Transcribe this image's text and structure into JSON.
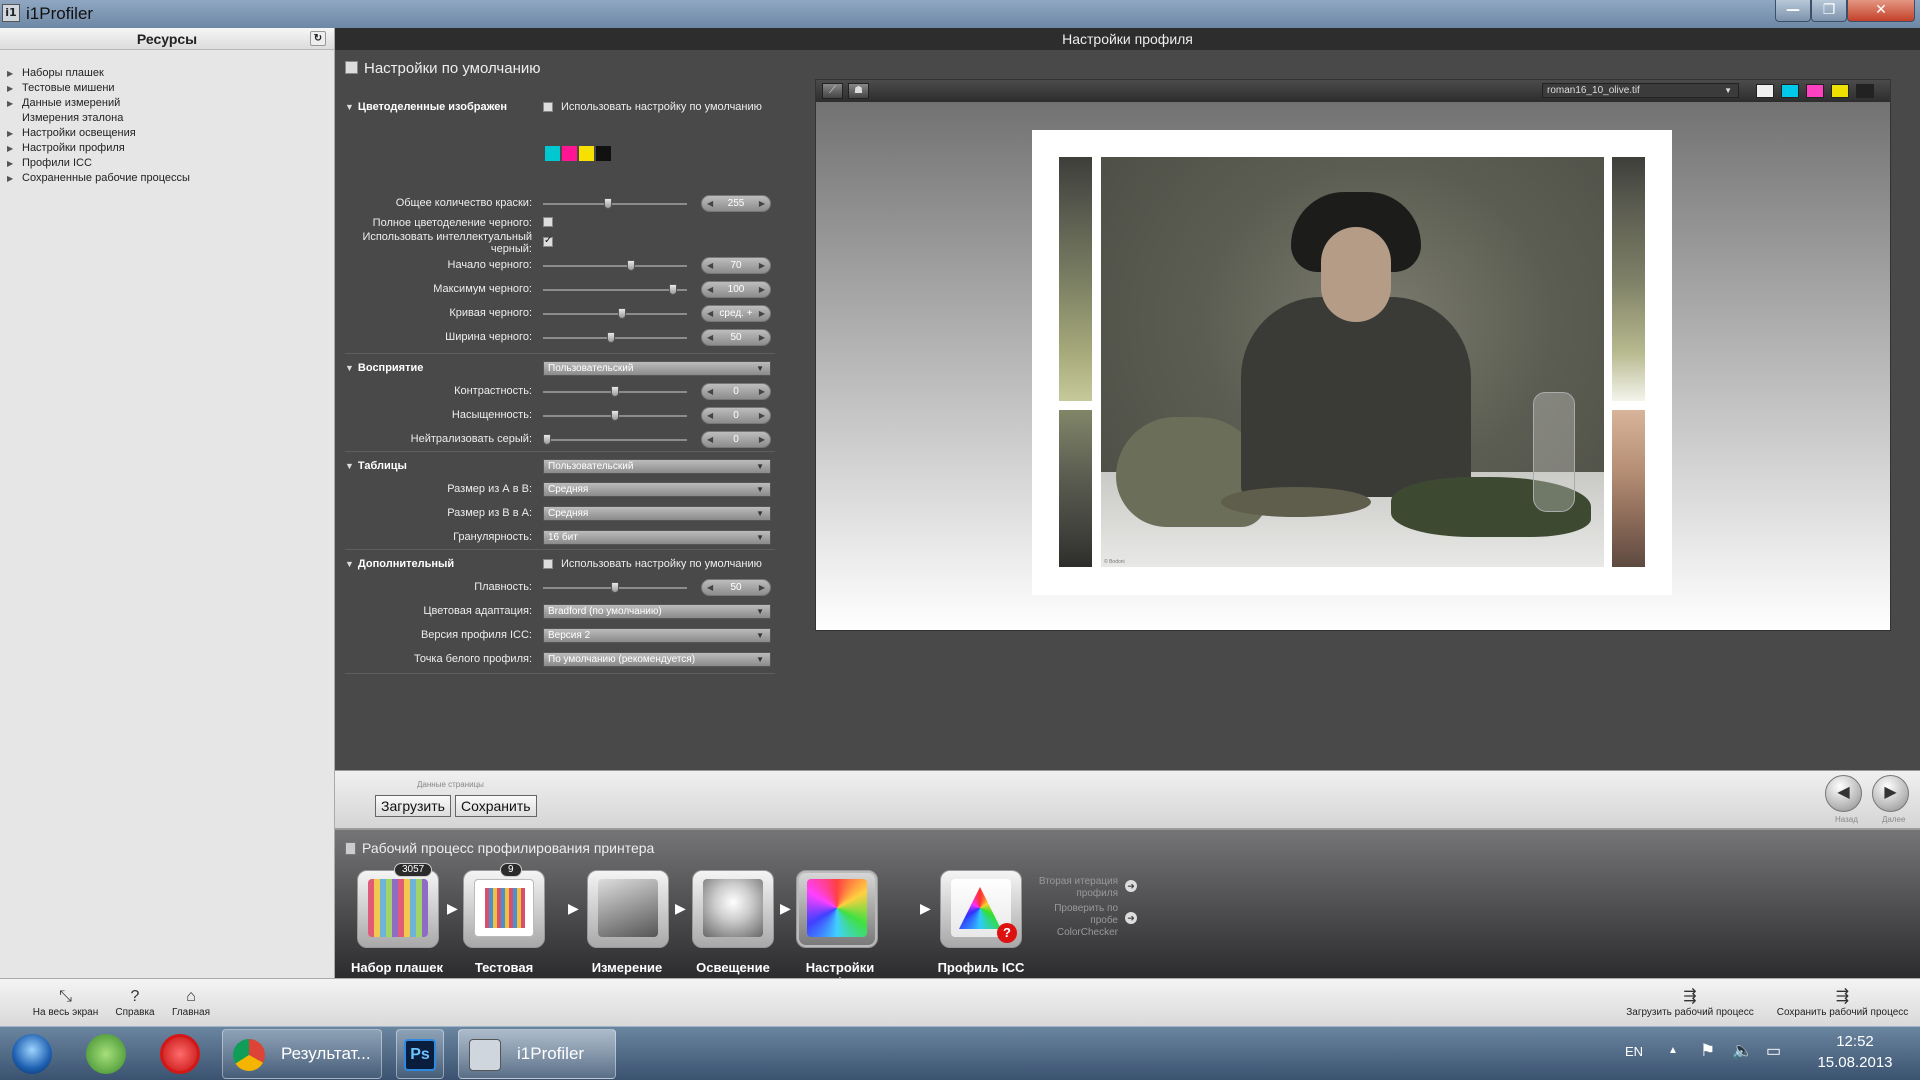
{
  "window": {
    "title": "i1Profiler",
    "app_icon_text": "i1",
    "min_label": "—",
    "max_label": "❐",
    "close_label": "✕"
  },
  "resources": {
    "header": "Ресурсы",
    "items": [
      "Наборы плашек",
      "Тестовые мишени",
      "Данные измерений",
      "Измерения эталона",
      "Настройки освещения",
      "Настройки профиля",
      "Профили ICC",
      "Сохраненные рабочие процессы"
    ]
  },
  "main": {
    "header": "Настройки профиля",
    "settings_title": "Настройки по умолчанию"
  },
  "separation": {
    "section": "Цветоделенные изображен",
    "use_default": "Использовать настройку по умолчанию",
    "use_default_checked": false,
    "swatch_colors": [
      "#00c8d0",
      "#ff1493",
      "#f5e000",
      "#111111"
    ],
    "total_ink_label": "Общее количество краски:",
    "total_ink_value": "255",
    "total_ink_pos": 0.45,
    "full_black_label": "Полное цветоделение черного:",
    "full_black_checked": false,
    "smart_black_label1": "Использовать интеллектуальный",
    "smart_black_label2": "черный:",
    "smart_black_checked": true,
    "black_start_label": "Начало черного:",
    "black_start_value": "70",
    "black_start_pos": 0.62,
    "black_max_label": "Максимум черного:",
    "black_max_value": "100",
    "black_max_pos": 0.93,
    "black_curve_label": "Кривая черного:",
    "black_curve_value": "сред. +",
    "black_curve_pos": 0.55,
    "black_width_label": "Ширина черного:",
    "black_width_value": "50",
    "black_width_pos": 0.47
  },
  "perception": {
    "section": "Восприятие",
    "preset": "Пользовательский",
    "contrast_label": "Контрастность:",
    "contrast_value": "0",
    "contrast_pos": 0.5,
    "saturation_label": "Насыщенность:",
    "saturation_value": "0",
    "saturation_pos": 0.5,
    "neutral_gray_label": "Нейтрализовать серый:",
    "neutral_gray_value": "0",
    "neutral_gray_pos": 0.0
  },
  "tables": {
    "section": "Таблицы",
    "preset": "Пользовательский",
    "a2b_label": "Размер из А в В:",
    "a2b_value": "Средняя",
    "b2a_label": "Размер из В в А:",
    "b2a_value": "Средняя",
    "granularity_label": "Гранулярность:",
    "granularity_value": "16 бит"
  },
  "additional": {
    "section": "Дополнительный",
    "use_default": "Использовать настройку по умолчанию",
    "use_default_checked": false,
    "smoothness_label": "Плавность:",
    "smoothness_value": "50",
    "smoothness_pos": 0.5,
    "chromatic_label": "Цветовая адаптация:",
    "chromatic_value": "Bradford (по умолчанию)",
    "icc_version_label": "Версия профиля ICC:",
    "icc_version_value": "Версия 2",
    "white_point_label": "Точка белого профиля:",
    "white_point_value": "По умолчанию (рекомендуется)"
  },
  "preview": {
    "image_name": "roman16_10_olive.tif",
    "copyright": "© Bodoni",
    "channel_colors": [
      "#f0f0f0",
      "#00c8e8",
      "#ff40c0",
      "#f0e000",
      "#222222"
    ]
  },
  "page_data": {
    "caption": "Данные страницы",
    "load_label": "Загрузить",
    "save_label": "Сохранить",
    "back_label": "Назад",
    "next_label": "Далее"
  },
  "workflow": {
    "title": "Рабочий процесс профилирования принтера",
    "steps": [
      {
        "label": "Набор плашек",
        "badge": "3057"
      },
      {
        "label": "Тестовая мишень",
        "badge": "9"
      },
      {
        "label": "Измерение",
        "badge": ""
      },
      {
        "label": "Освещение",
        "badge": ""
      },
      {
        "label": "Настройки профиля",
        "badge": ""
      },
      {
        "label": "Профиль ICC",
        "badge": ""
      }
    ],
    "link1_line1": "Вторая итерация",
    "link1_line2": "профиля",
    "link2_line1": "Проверить по",
    "link2_line2": "пробе",
    "link2_line3": "ColorChecker"
  },
  "app_toolbar": {
    "fullscreen": "На весь экран",
    "help": "Справка",
    "home": "Главная",
    "load_workflow": "Загрузить рабочий процесс",
    "save_workflow": "Сохранить рабочий процесс"
  },
  "taskbar": {
    "chrome_task": "Результат...",
    "ps_label": "Ps",
    "i1_task": "i1Profiler",
    "lang": "EN",
    "time": "12:52",
    "date": "15.08.2013"
  }
}
